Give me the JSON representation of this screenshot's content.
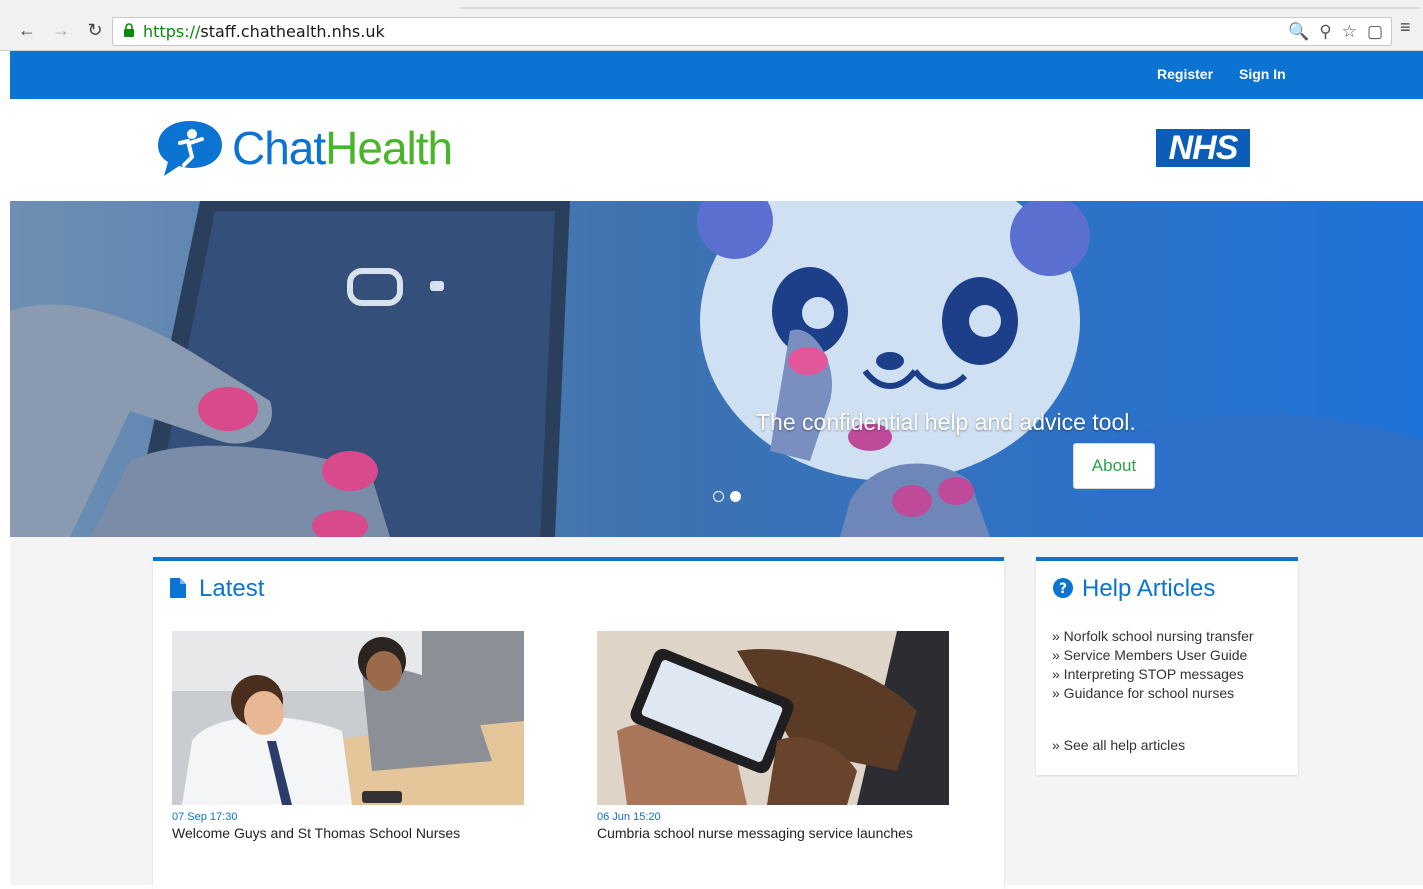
{
  "browser": {
    "url_protocol": "https://",
    "url_host": "staff.chathealth.nhs.uk"
  },
  "topbar": {
    "register": "Register",
    "signin": "Sign In"
  },
  "brand": {
    "name_part1": "Chat",
    "name_part2": "Health",
    "nhs": "NHS"
  },
  "hero": {
    "tagline": "The confidential help and advice tool.",
    "about_label": "About"
  },
  "latest": {
    "title": "Latest",
    "items": [
      {
        "date": "07 Sep 17:30",
        "headline": "Welcome Guys and St Thomas School Nurses"
      },
      {
        "date": "06 Jun 15:20",
        "headline": "Cumbria school nurse messaging service launches"
      }
    ]
  },
  "help": {
    "title": "Help Articles",
    "items": [
      "» Norfolk school nursing transfer",
      "» Service Members User Guide",
      "» Interpreting STOP messages",
      "» Guidance for school nurses"
    ],
    "see_all": "» See all help articles"
  },
  "colors": {
    "brand_blue": "#0b73d1",
    "brand_green": "#49b52a",
    "nhs_blue": "#0b5db7"
  }
}
